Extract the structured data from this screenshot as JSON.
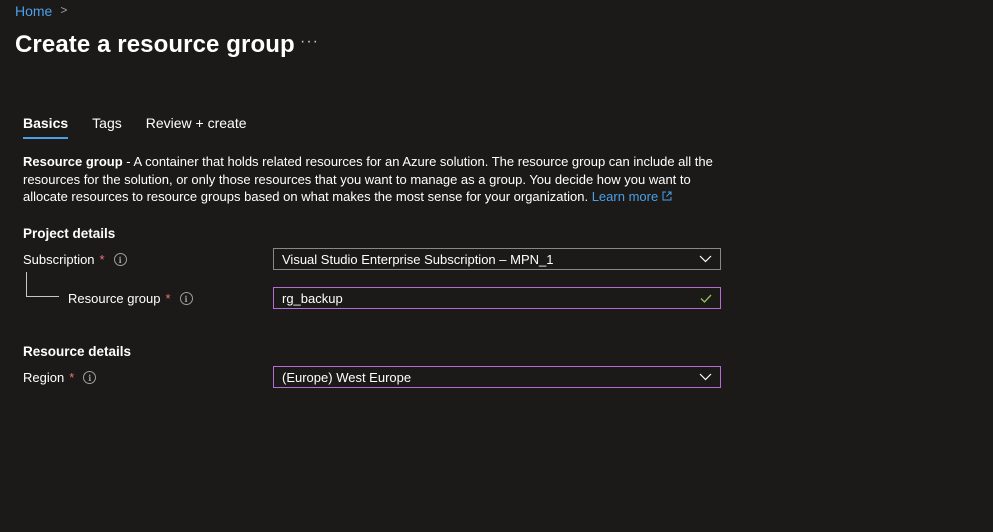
{
  "breadcrumb": {
    "home": "Home",
    "separator": ">"
  },
  "page": {
    "title": "Create a resource group",
    "more": "···"
  },
  "tabs": [
    {
      "label": "Basics",
      "active": true
    },
    {
      "label": "Tags",
      "active": false
    },
    {
      "label": "Review + create",
      "active": false
    }
  ],
  "description": {
    "bold": "Resource group",
    "text": " - A container that holds related resources for an Azure solution. The resource group can include all the resources for the solution, or only those resources that you want to manage as a group. You decide how you want to allocate resources to resource groups based on what makes the most sense for your organization. ",
    "link": "Learn more"
  },
  "project_details": {
    "heading": "Project details",
    "subscription": {
      "label": "Subscription",
      "required": "*",
      "value": "Visual Studio Enterprise Subscription – MPN_1"
    },
    "resource_group": {
      "label": "Resource group",
      "required": "*",
      "value": "rg_backup"
    }
  },
  "resource_details": {
    "heading": "Resource details",
    "region": {
      "label": "Region",
      "required": "*",
      "value": "(Europe) West Europe"
    }
  },
  "colors": {
    "accent": "#4aa0e6",
    "focus": "#b46dd2",
    "required": "#f1707b",
    "valid": "#92c353",
    "background": "#1b1a19"
  },
  "icons": {
    "info": "info-icon",
    "chevron": "chevron-down-icon",
    "check": "checkmark-icon",
    "external": "external-link-icon"
  }
}
